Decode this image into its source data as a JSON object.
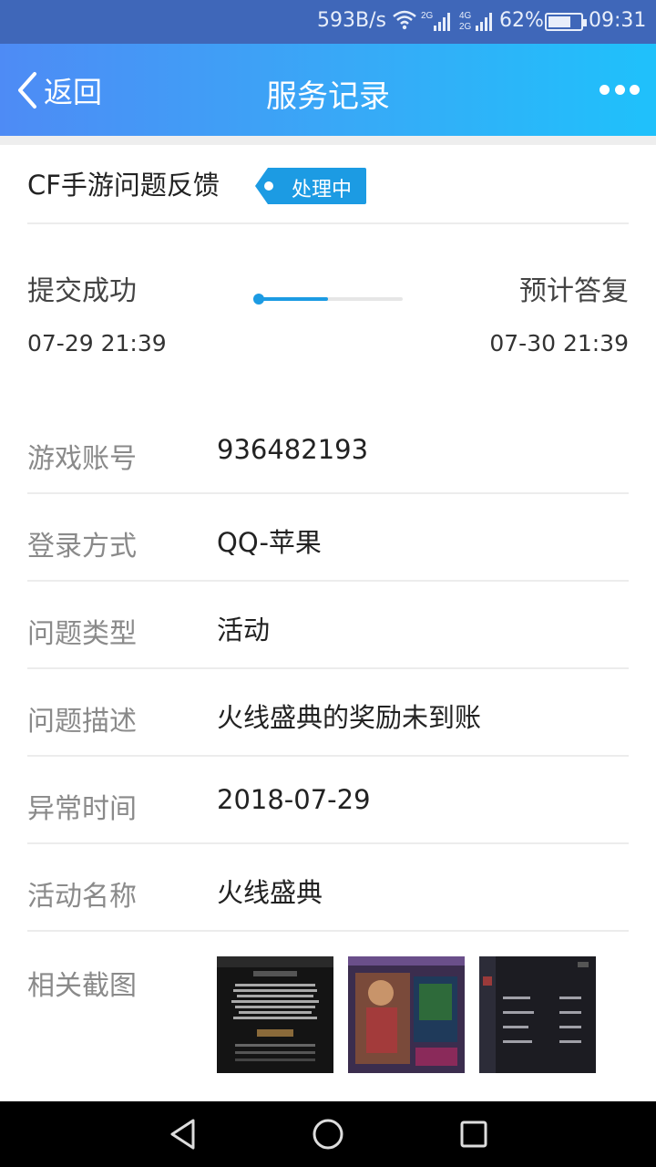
{
  "status_bar": {
    "net_speed": "593B/s",
    "wifi_icon": "wifi-icon",
    "signal_1": "2G",
    "signal_2_top": "4G",
    "signal_2_bottom": "2G",
    "battery_pct": "62%",
    "time": "09:31"
  },
  "nav": {
    "back_label": "返回",
    "title": "服务记录",
    "more_icon": "more-icon"
  },
  "record": {
    "topic": "CF手游问题反馈",
    "status_tag": "处理中",
    "progress_fraction": 0.48,
    "submitted_label": "提交成功",
    "submitted_time": "07-29 21:39",
    "expected_label": "预计答复",
    "expected_time": "07-30 21:39"
  },
  "fields": [
    {
      "label": "游戏账号",
      "value": "936482193"
    },
    {
      "label": "登录方式",
      "value": "QQ-苹果"
    },
    {
      "label": "问题类型",
      "value": "活动"
    },
    {
      "label": "问题描述",
      "value": "火线盛典的奖励未到账"
    },
    {
      "label": "异常时间",
      "value": "2018-07-29"
    },
    {
      "label": "活动名称",
      "value": "火线盛典"
    }
  ],
  "screenshots": {
    "label": "相关截图",
    "items": [
      "screenshot-1",
      "screenshot-2",
      "screenshot-3"
    ]
  },
  "colors": {
    "accent": "#1c9be3",
    "nav_start": "#4e8bf5",
    "nav_end": "#1fc1fb"
  }
}
